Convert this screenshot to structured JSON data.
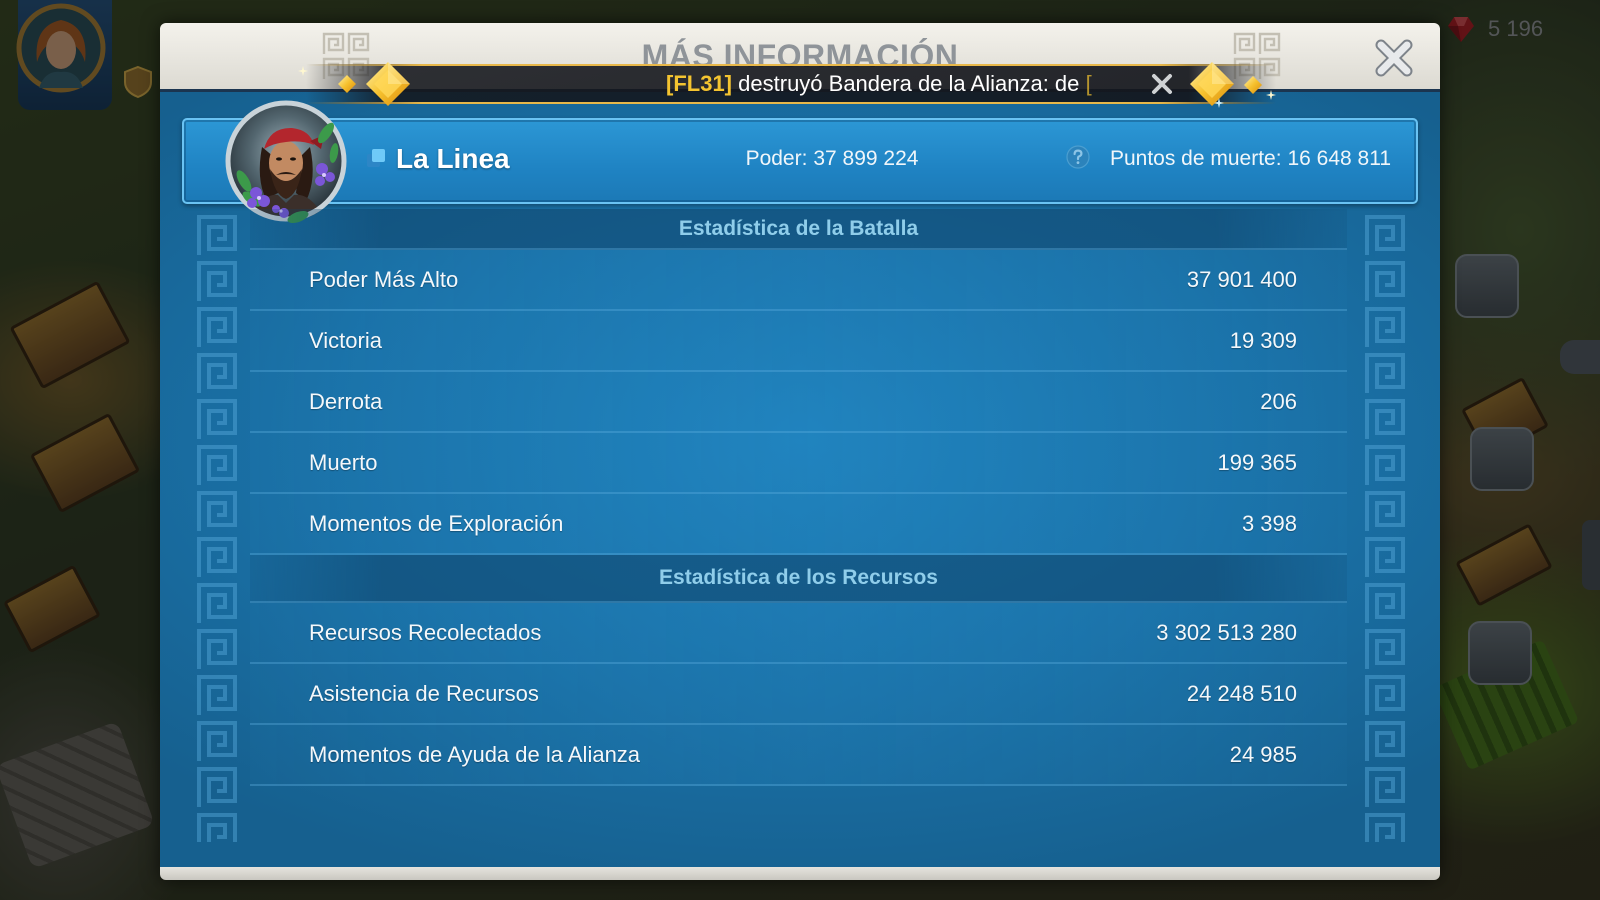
{
  "hud": {
    "resource_icon": "gem-icon",
    "resource_value": "5 196",
    "avatar_icon": "player-portrait-icon"
  },
  "dialog": {
    "title": "MÁS INFORMACIÓN",
    "close_icon": "close-icon"
  },
  "notification": {
    "alliance_tag": "[FL31]",
    "message": "destruyó Bandera de la Alianza: de",
    "trailing_tag": "[",
    "dismiss_icon": "close-icon"
  },
  "player": {
    "name": "La Linea",
    "name_icon": "copy-icon",
    "power_label": "Poder:",
    "power_value": "37 899 224",
    "death_points_label": "Puntos de muerte:",
    "death_points_value": "16 648 811",
    "help_icon": "question-icon"
  },
  "sections": [
    {
      "title": "Estadística de la Batalla",
      "rows": [
        {
          "label": "Poder Más Alto",
          "value": "37 901 400"
        },
        {
          "label": "Victoria",
          "value": "19 309"
        },
        {
          "label": "Derrota",
          "value": "206"
        },
        {
          "label": "Muerto",
          "value": "199 365"
        },
        {
          "label": "Momentos de Exploración",
          "value": "3 398"
        }
      ]
    },
    {
      "title": "Estadística de los Recursos",
      "rows": [
        {
          "label": "Recursos Recolectados",
          "value": "3 302 513 280"
        },
        {
          "label": "Asistencia de Recursos",
          "value": "24 248 510"
        },
        {
          "label": "Momentos de Ayuda de la Alianza",
          "value": "24 985"
        }
      ]
    }
  ],
  "colors": {
    "panel_blue": "#1a71a7",
    "card_blue": "#1f83c3",
    "section_title": "#8fcdea",
    "alliance_tag": "#f4c430",
    "title_gray": "#8f9499"
  }
}
